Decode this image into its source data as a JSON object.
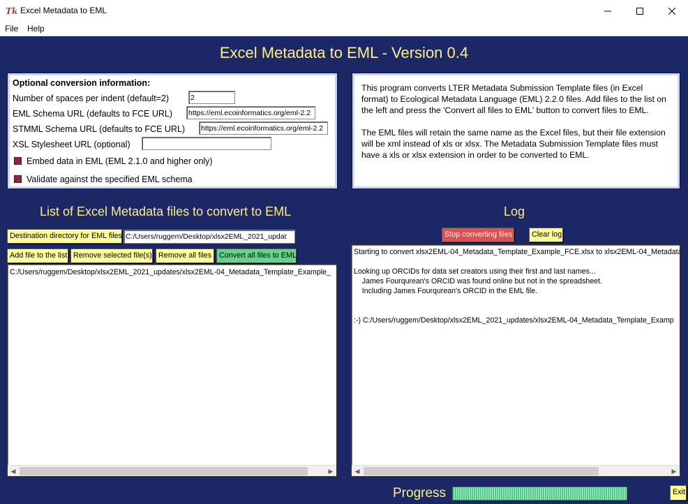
{
  "window": {
    "title": "Excel Metadata to EML",
    "icon_label": "Tk"
  },
  "menu": [
    "File",
    "Help"
  ],
  "app_title": "Excel Metadata to EML - Version 0.4",
  "options": {
    "heading": "Optional conversion information:",
    "indent_label": "Number of spaces per indent (default=2)",
    "indent_value": "2",
    "eml_url_label": "EML Schema URL (defaults to FCE URL)",
    "eml_url_value": "https://eml.ecoinformatics.org/eml-2.2",
    "stmml_url_label": "STMML Schema URL (defaults to FCE URL)",
    "stmml_url_value": "https://eml.ecoinformatics.org/eml-2.2",
    "xsl_label": "XSL Stylesheet URL (optional)",
    "xsl_value": "",
    "embed_label": "Embed data in EML (EML 2.1.0 and higher only)",
    "validate_label": "Validate against the specified EML schema"
  },
  "info": {
    "paragraph1": "This program converts LTER Metadata Submission Template files (in Excel format) to Ecological Metadata Language (EML) 2.2.0 files. Add files to the list on the left and press the 'Convert all files to EML' button to convert files to EML.",
    "paragraph2": "The EML files will retain the same name as the Excel files, but their file extension will be xml instead of xls or xlsx.  The Metadata Submission Template files must have a xls or xlsx extension in order to be converted to EML."
  },
  "files_section": {
    "title": "List of Excel Metadata files to convert to EML",
    "dest_button": "Destination directory for EML files",
    "dest_value": "C:/Users/ruggem/Desktop/xlsx2EML_2021_updat",
    "add_button": "Add file to the list",
    "remove_selected_button": "Remove selected file(s)",
    "remove_all_button": "Remove all files",
    "convert_button": "Convert all files to EML",
    "files": [
      "C:/Users/ruggem/Desktop/xlsx2EML_2021_updates/xlsx2EML-04_Metadata_Template_Example_"
    ]
  },
  "log_section": {
    "title": "Log",
    "stop_button": "Stop converting files",
    "clear_button": "Clear log",
    "lines": [
      "Starting to convert xlsx2EML-04_Metadata_Template_Example_FCE.xlsx to xlsx2EML-04_Metadata",
      "",
      "Looking up ORCIDs for data set creators using their first and last names...",
      "    James Fourqurean's ORCID was found online but not in the spreadsheet.",
      "    Including James Fourqurean's ORCID in the EML file.",
      "",
      "",
      ":-)  C:/Users/ruggem/Desktop/xlsx2EML_2021_updates/xlsx2EML-04_Metadata_Template_Examp"
    ]
  },
  "progress": {
    "label": "Progress",
    "fraction": 1.0
  },
  "exit_button": "Exit",
  "colors": {
    "background": "#1c2866",
    "title_text": "#ffec8b",
    "button_yellow": "#fffe99",
    "button_green": "#5fd68a",
    "button_red": "#e05050",
    "progress_green": "#4ec98a"
  },
  "icons": [
    "tk-feather-icon",
    "minimize-icon",
    "maximize-icon",
    "close-icon",
    "scroll-left-icon",
    "scroll-right-icon"
  ]
}
